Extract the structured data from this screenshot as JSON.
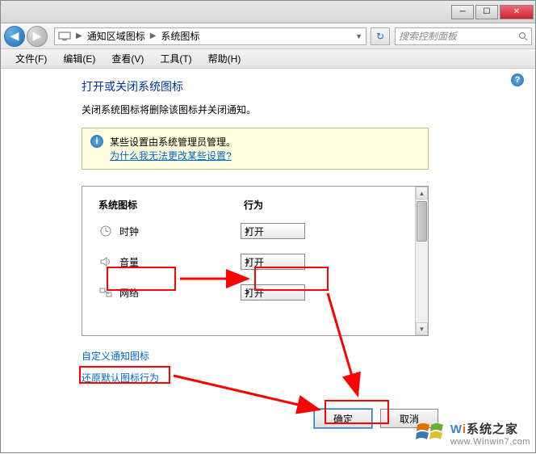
{
  "titlebar": {
    "minimize": "─",
    "maximize": "☐",
    "close": "✕"
  },
  "nav": {
    "back": "◀",
    "forward": "▶",
    "crumb1": "通知区域图标",
    "crumb2": "系统图标",
    "refresh": "↻",
    "search_placeholder": "搜索控制面板"
  },
  "menu": {
    "file": "文件(F)",
    "edit": "编辑(E)",
    "view": "查看(V)",
    "tools": "工具(T)",
    "help": "帮助(H)"
  },
  "page": {
    "title": "打开或关闭系统图标",
    "desc": "关闭系统图标将删除该图标并关闭通知。",
    "info_line1": "某些设置由系统管理员管理。",
    "info_link": "为什么我无法更改某些设置?",
    "col_icon": "系统图标",
    "col_behavior": "行为",
    "rows": [
      {
        "label": "时钟",
        "value": "打开"
      },
      {
        "label": "音量",
        "value": "打开"
      },
      {
        "label": "网络",
        "value": "打开"
      }
    ],
    "link_customize": "自定义通知图标",
    "link_restore": "还原默认图标行为",
    "btn_ok": "确定",
    "btn_cancel": "取消"
  },
  "help_icon": "?",
  "watermark": {
    "brand1": "W",
    "brand2": "i",
    "brand3": "系统之家",
    "url": "www.Winwin7.com"
  }
}
